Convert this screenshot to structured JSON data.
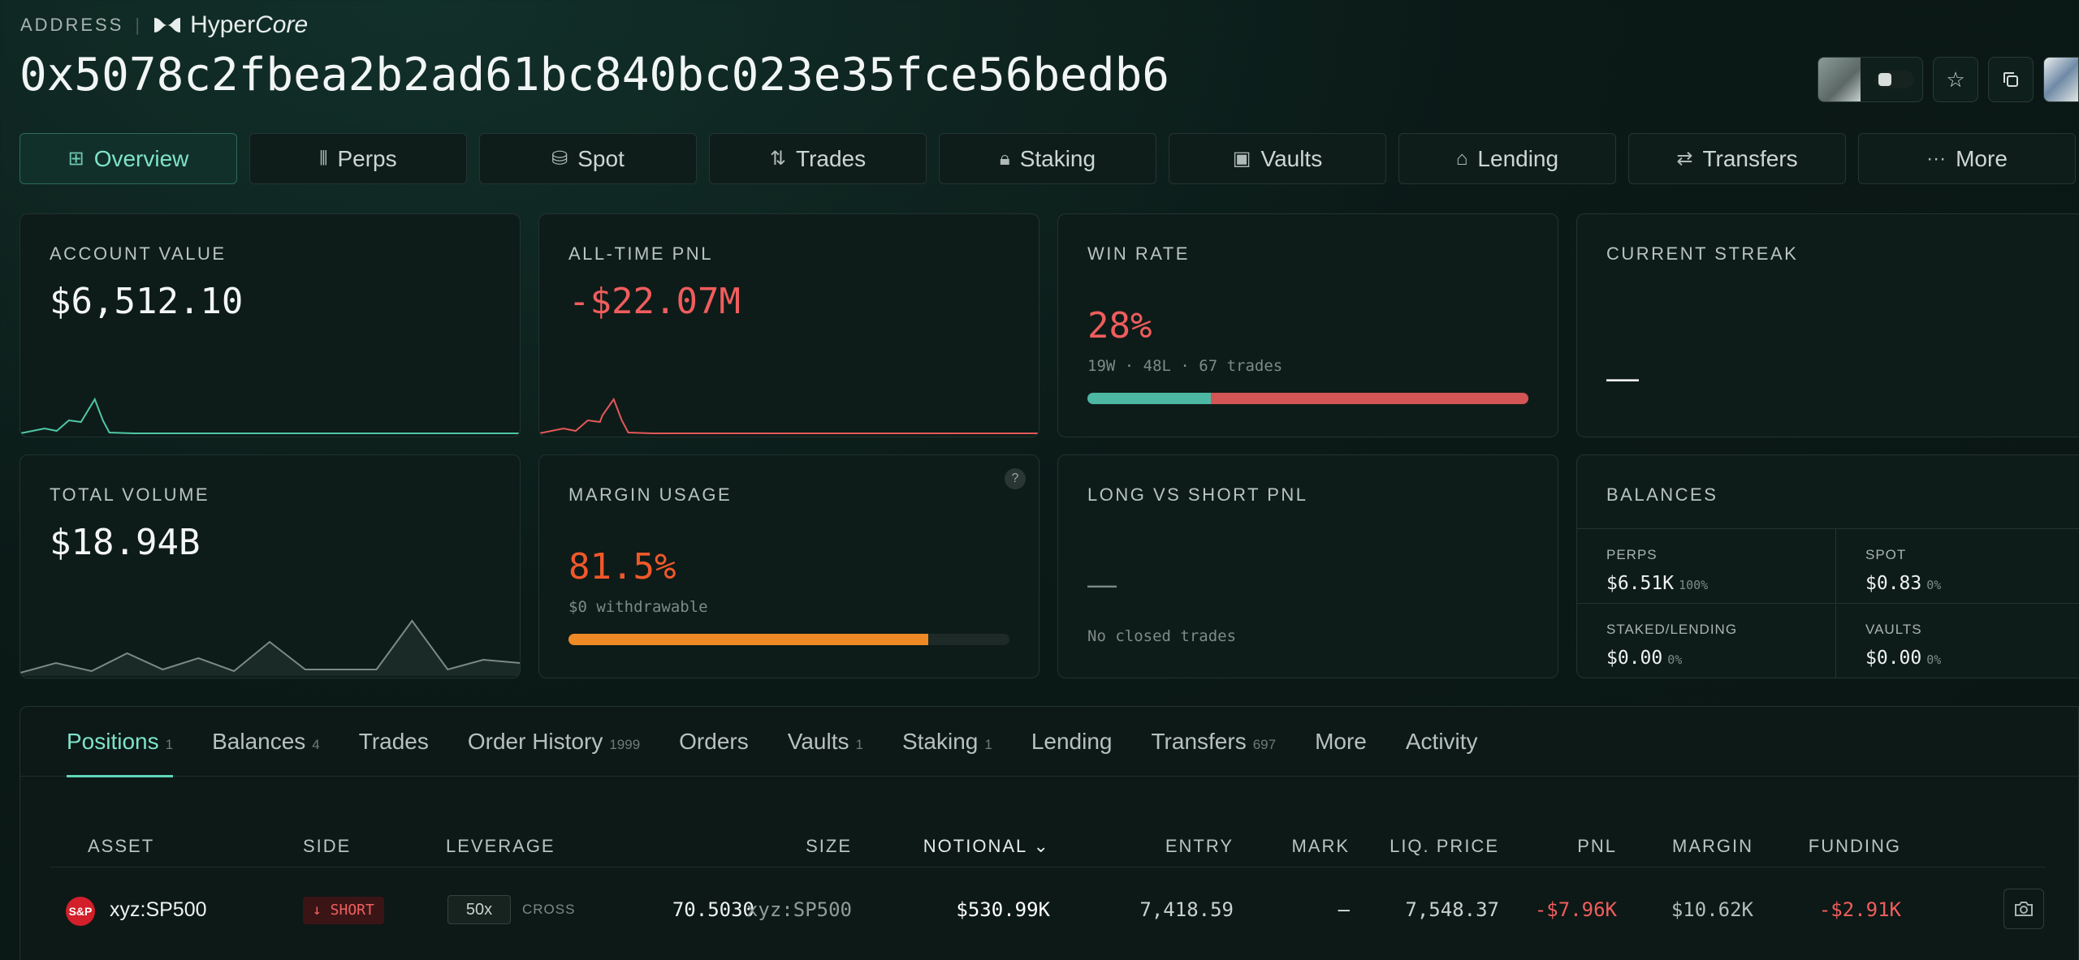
{
  "header": {
    "section_label": "ADDRESS",
    "separator": "|",
    "brand_name_plain": "Hyper",
    "brand_name_italic": "Core",
    "address": "0x5078c2fbea2b2ad61bc840bc023e35fce56bedb6"
  },
  "nav": [
    {
      "label": "Overview",
      "icon": "grid-icon",
      "glyph": "⊞",
      "active": true
    },
    {
      "label": "Perps",
      "icon": "candles-icon",
      "glyph": "⫴"
    },
    {
      "label": "Spot",
      "icon": "coins-icon",
      "glyph": "⛁"
    },
    {
      "label": "Trades",
      "icon": "arrows-updown-icon",
      "glyph": "⇅"
    },
    {
      "label": "Staking",
      "icon": "lock-icon",
      "glyph": "🔒︎"
    },
    {
      "label": "Vaults",
      "icon": "vault-icon",
      "glyph": "▣"
    },
    {
      "label": "Lending",
      "icon": "bank-icon",
      "glyph": "⌂"
    },
    {
      "label": "Transfers",
      "icon": "transfer-icon",
      "glyph": "⇄"
    },
    {
      "label": "More",
      "icon": "ellipsis-icon",
      "glyph": "···"
    }
  ],
  "cards": {
    "account_value": {
      "title": "ACCOUNT VALUE",
      "value": "$6,512.10"
    },
    "all_time_pnl": {
      "title": "ALL-TIME PNL",
      "value": "-$22.07M"
    },
    "win_rate": {
      "title": "WIN RATE",
      "value": "28%",
      "detail": "19W · 48L · 67 trades",
      "win_fraction": 0.28
    },
    "current_streak": {
      "title": "CURRENT STREAK",
      "value": "—"
    },
    "total_volume": {
      "title": "TOTAL VOLUME",
      "value": "$18.94B"
    },
    "margin_usage": {
      "title": "MARGIN USAGE",
      "value": "81.5%",
      "detail": "$0 withdrawable",
      "fill_fraction": 0.815,
      "help": "?"
    },
    "long_short": {
      "title": "LONG VS SHORT PNL",
      "value": "—",
      "detail": "No closed trades"
    },
    "balances": {
      "title": "BALANCES",
      "items": [
        {
          "label": "PERPS",
          "value": "$6.51K",
          "pct": "100%"
        },
        {
          "label": "SPOT",
          "value": "$0.83",
          "pct": "0%"
        },
        {
          "label": "STAKED/LENDING",
          "value": "$0.00",
          "pct": "0%"
        },
        {
          "label": "VAULTS",
          "value": "$0.00",
          "pct": "0%"
        }
      ]
    }
  },
  "colors": {
    "accent": "#5fd6b8",
    "loss": "#f05d5d",
    "win": "#4cb8a4",
    "margin": "#ee8a26"
  },
  "tabs": [
    {
      "label": "Positions",
      "count": "1",
      "active": true
    },
    {
      "label": "Balances",
      "count": "4"
    },
    {
      "label": "Trades",
      "count": ""
    },
    {
      "label": "Order History",
      "count": "1999"
    },
    {
      "label": "Orders",
      "count": ""
    },
    {
      "label": "Vaults",
      "count": "1"
    },
    {
      "label": "Staking",
      "count": "1"
    },
    {
      "label": "Lending",
      "count": ""
    },
    {
      "label": "Transfers",
      "count": "697"
    },
    {
      "label": "More",
      "count": ""
    },
    {
      "label": "Activity",
      "count": ""
    }
  ],
  "table": {
    "headers": {
      "asset": "ASSET",
      "side": "SIDE",
      "leverage": "LEVERAGE",
      "size": "SIZE",
      "notional": "NOTIONAL ⌄",
      "entry": "ENTRY",
      "mark": "MARK",
      "liq": "LIQ. PRICE",
      "pnl": "PNL",
      "margin": "MARGIN",
      "funding": "FUNDING"
    },
    "row": {
      "asset_logo": "S&P",
      "asset": "xyz:SP500",
      "side": "↓ SHORT",
      "leverage": "50x",
      "leverage_mode": "CROSS",
      "size": "70.5030",
      "size_unit": "xyz:SP500",
      "notional": "$530.99K",
      "entry": "7,418.59",
      "mark": "—",
      "liq": "7,548.37",
      "pnl": "-$7.96K",
      "margin": "$10.62K",
      "funding": "-$2.91K"
    }
  }
}
